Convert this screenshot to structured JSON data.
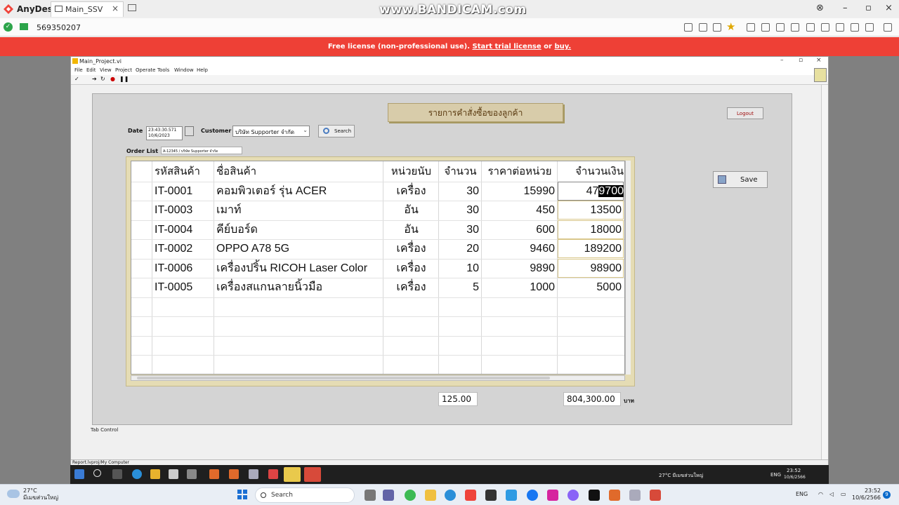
{
  "anydesk": {
    "app_name": "AnyDesk",
    "tab_label": "Main_SSV",
    "watermark": "www.BANDICAM.com",
    "remote_id": "569350207",
    "license_prefix": "Free license (non-professional use).",
    "license_trial": "Start trial license",
    "license_or": "or",
    "license_buy": "buy."
  },
  "labview": {
    "window_title": "Main_Project.vi",
    "menu": [
      "File",
      "Edit",
      "View",
      "Project",
      "Operate",
      "Tools",
      "Window",
      "Help"
    ],
    "panel_title": "รายการคำสั่งซื้อของลูกค้า",
    "logout_label": "Logout",
    "date_label": "Date",
    "date_time": "23:43:30.571",
    "date_date": "10/6/2023",
    "customer_label": "Customer",
    "customer_value": "บริษัท Supporter จำกัด",
    "search_label": "Search",
    "order_list_label": "Order List",
    "order_list_value": "A-12345 / บริษัท Supporter จำกัด",
    "save_label": "Save",
    "tab_control_label": "Tab Control",
    "status_path": "Report.lvproj/My Computer",
    "table": {
      "headers": [
        "รหัสสินค้า",
        "ชื่อสินค้า",
        "หน่วยนับ",
        "จำนวน",
        "ราคาต่อหน่วย",
        "จำนวนเงิน"
      ],
      "rows": [
        [
          "IT-0001",
          "คอมพิวเตอร์ รุ่น ACER",
          "เครื่อง",
          "30",
          "15990",
          "479700"
        ],
        [
          "IT-0003",
          "เมาท์",
          "อัน",
          "30",
          "450",
          "13500"
        ],
        [
          "IT-0004",
          "คีย์บอร์ด",
          "อัน",
          "30",
          "600",
          "18000"
        ],
        [
          "IT-0002",
          "OPPO A78 5G",
          "เครื่อง",
          "20",
          "9460",
          "189200"
        ],
        [
          "IT-0006",
          "เครื่องปริ้น RICOH Laser Color",
          "เครื่อง",
          "10",
          "9890",
          "98900"
        ],
        [
          "IT-0005",
          "เครื่องสแกนลายนิ้วมือ",
          "เครื่อง",
          "5",
          "1000",
          "5000"
        ]
      ],
      "first_amount_prefix": "47",
      "first_amount_selected": "9700"
    },
    "total_qty": "125.00",
    "total_amount": "804,300.00",
    "currency": "บาท"
  },
  "remote_taskbar": {
    "weather": "27°C มีเมฆส่วนใหญ่",
    "lang": "ENG",
    "time": "23:52",
    "date": "10/6/2566"
  },
  "local_taskbar": {
    "temp": "27°C",
    "weather_desc": "มีเมฆส่วนใหญ่",
    "search_placeholder": "Search",
    "lang": "ENG",
    "time": "23:52",
    "date": "10/6/2566",
    "notif_count": "9"
  },
  "colors": {
    "license_bar": "#ee4036",
    "title_panel": "#d8ccaa",
    "table_frame": "#e5dcb4",
    "anydesk_red": "#ef443b"
  }
}
